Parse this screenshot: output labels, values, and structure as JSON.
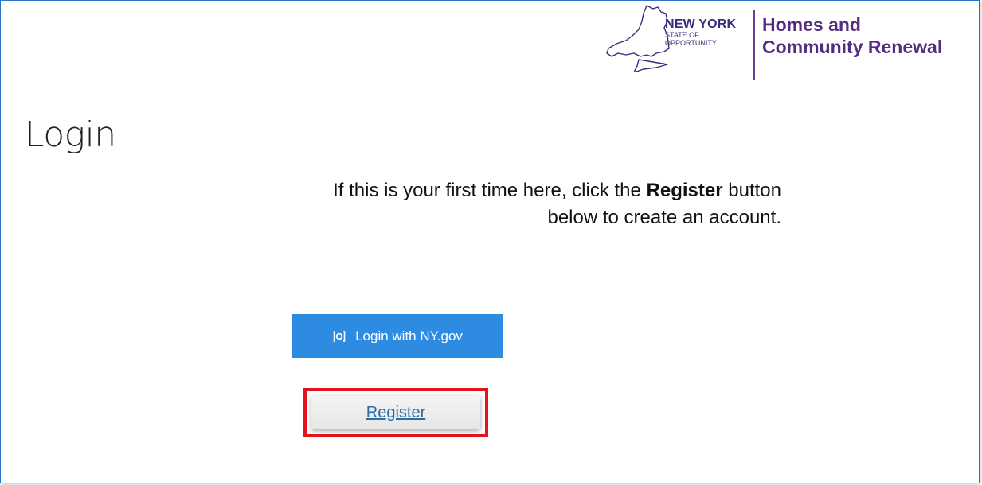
{
  "header": {
    "ny_logo": {
      "line1": "NEW YORK",
      "line2": "STATE OF",
      "line3": "OPPORTUNITY.",
      "icon": "ny-state-map-icon"
    },
    "agency_line1": "Homes and",
    "agency_line2": "Community Renewal"
  },
  "page": {
    "title": "Login",
    "instruction_part1": "If this is your first time here, click the ",
    "instruction_bold": "Register",
    "instruction_part2": " button",
    "instruction_line2": "below to create an account."
  },
  "actions": {
    "login_label": "Login with NY.gov",
    "login_icon": "nygov-login-icon",
    "register_label": "Register"
  },
  "colors": {
    "accent": "#2d8ce2",
    "agency_purple": "#522d7f",
    "highlight_border": "#e3141b",
    "link": "#2b6ca3"
  }
}
